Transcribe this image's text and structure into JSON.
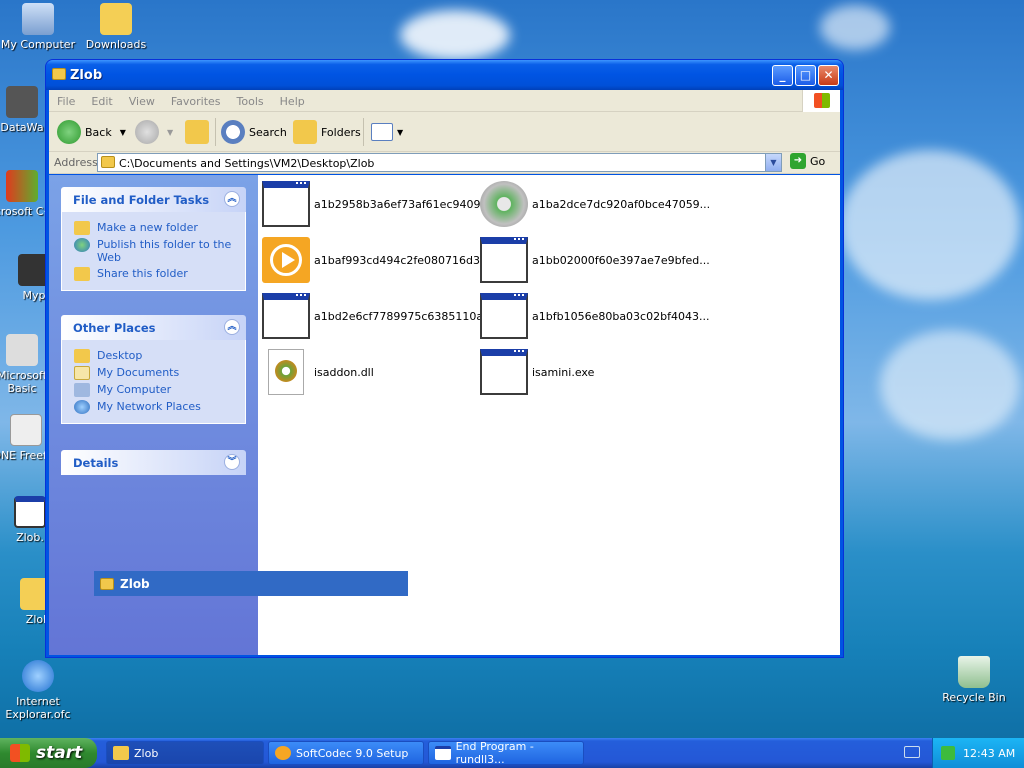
{
  "desktop": {
    "icons": [
      {
        "label": "My Computer"
      },
      {
        "label": "Downloads"
      },
      {
        "label": "DataWa"
      },
      {
        "label": "Microsoft C++"
      },
      {
        "label": "Myp"
      },
      {
        "label": "Microsoft Basic"
      },
      {
        "label": "ONE Freefall"
      },
      {
        "label": "Zlob."
      },
      {
        "label": "Zlol"
      },
      {
        "label": "Internet Explorar.ofc"
      },
      {
        "label": "Recycle Bin"
      }
    ]
  },
  "window": {
    "title": "Zlob",
    "buttons": {
      "minimize": "_",
      "maximize": "□",
      "close": "✕"
    },
    "menu": [
      "File",
      "Edit",
      "View",
      "Favorites",
      "Tools",
      "Help"
    ],
    "toolbar": {
      "back": "Back",
      "search": "Search",
      "folders": "Folders"
    },
    "address": {
      "label": "Address",
      "value": "C:\\Documents and Settings\\VM2\\Desktop\\Zlob",
      "go": "Go"
    },
    "tasks_panel": {
      "title": "File and Folder Tasks",
      "items": [
        "Make a new folder",
        "Publish this folder to the Web",
        "Share this folder"
      ]
    },
    "places_panel": {
      "title": "Other Places",
      "items": [
        "Desktop",
        "My Documents",
        "My Computer",
        "My Network Places"
      ]
    },
    "details_panel": {
      "title": "Details"
    },
    "files": [
      {
        "name": "a1b2958b3a6ef73af61ec9409...",
        "icon": "window-app-icon"
      },
      {
        "name": "a1ba2dce7dc920af0bce47059...",
        "icon": "installer-disc-icon"
      },
      {
        "name": "a1baf993cd494c2fe080716d3...",
        "icon": "media-player-icon"
      },
      {
        "name": "a1bb02000f60e397ae7e9bfed...",
        "icon": "window-app-icon"
      },
      {
        "name": "a1bd2e6cf7789975c6385110a...",
        "icon": "window-app-icon"
      },
      {
        "name": "a1bfb1056e80ba03c02bf4043...",
        "icon": "window-app-icon"
      },
      {
        "name": "isaddon.dll",
        "icon": "dll-gear-icon"
      },
      {
        "name": "isamini.exe",
        "icon": "window-app-icon"
      }
    ],
    "drag_ghost": "Zlob"
  },
  "taskbar": {
    "start": "start",
    "tasks": [
      "Zlob",
      "SoftCodec 9.0 Setup",
      "End Program - rundll3..."
    ],
    "clock": "12:43 AM"
  },
  "colors": {
    "xp_blue": "#0054e3",
    "link_blue": "#215dc6",
    "selection": "#316ac5"
  }
}
